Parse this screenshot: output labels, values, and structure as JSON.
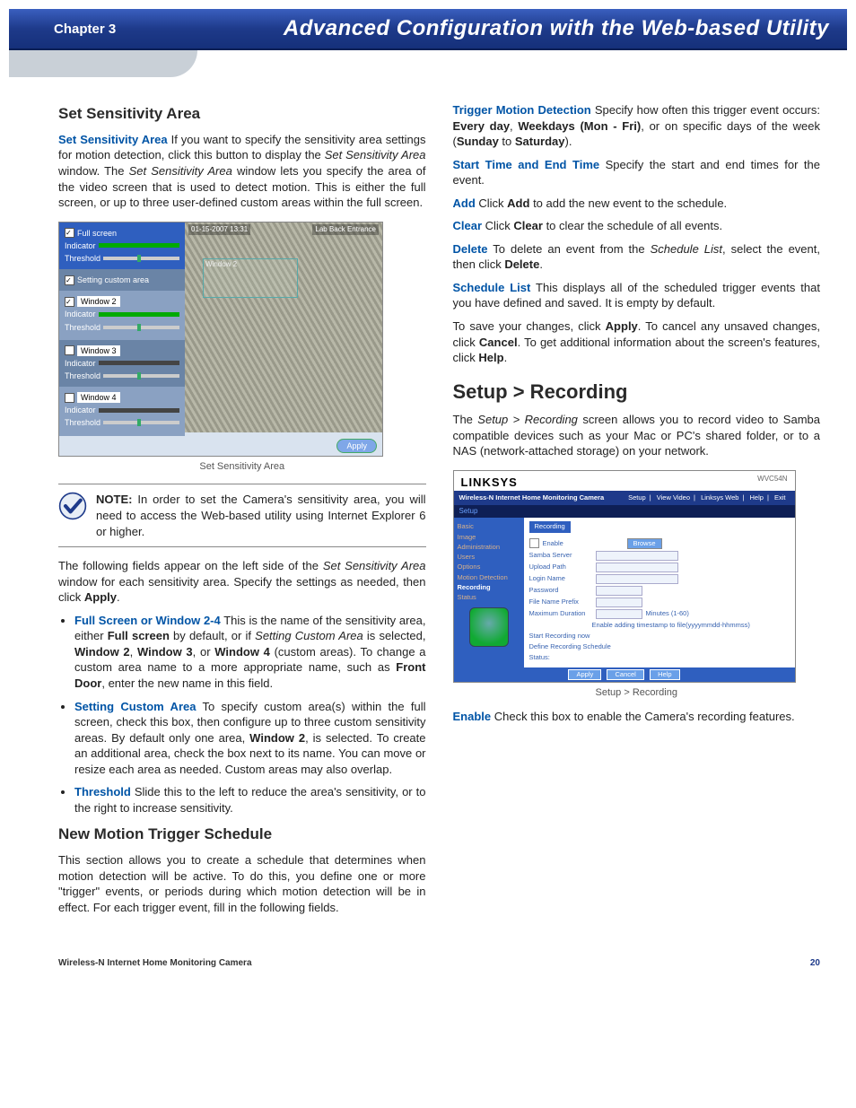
{
  "header": {
    "chapter": "Chapter 3",
    "title": "Advanced Configuration with the Web-based Utility"
  },
  "left": {
    "h2_1": "Set Sensitivity Area",
    "p1_lead": "Set Sensitivity Area",
    "p1_rest": "  If you want to specify the sensitivity area settings for motion detection, click this button to display the ",
    "p1_it1": "Set Sensitivity Area",
    "p1_mid": " window. The ",
    "p1_it2": "Set Sensitivity Area",
    "p1_end": " window lets you specify the area of the video screen that is used to detect motion. This is either the full screen, or up to three user-defined custom areas within the full screen.",
    "shot1": {
      "stamp_left": "01-15-2007 13:31",
      "stamp_right": "Lab Back Entrance",
      "winlabel": "Window 2",
      "groups": {
        "full": {
          "chk": true,
          "label": "Full screen",
          "ind": "Indicator",
          "thr": "Threshold"
        },
        "custom": {
          "chk": true,
          "label": "Setting custom area"
        },
        "w2": {
          "label": "Window 2",
          "ind": "Indicator",
          "thr": "Threshold"
        },
        "w3": {
          "label": "Window 3",
          "ind": "Indicator",
          "thr": "Threshold"
        },
        "w4": {
          "label": "Window 4",
          "ind": "Indicator",
          "thr": "Threshold"
        }
      },
      "apply": "Apply"
    },
    "cap1": "Set Sensitivity Area",
    "note_label": "NOTE:",
    "note_text": " In order to set the Camera's sensitivity area, you will need to access the Web-based utility using Internet Explorer 6 or higher.",
    "p2a": "The following fields appear on the left side of the ",
    "p2it": "Set Sensitivity Area",
    "p2b": " window for each sensitivity area. Specify the settings as needed, then click ",
    "p2bold": "Apply",
    "p2c": ".",
    "b1_lead": "Full Screen or Window 2-4",
    "b1_txt1": "  This is the name of the sensitivity area, either ",
    "b1_bold1": "Full screen",
    "b1_txt2": " by default, or if ",
    "b1_it": "Setting Custom Area",
    "b1_txt3": " is selected, ",
    "b1_bold2": "Window 2",
    "b1_sep1": ", ",
    "b1_bold3": "Window 3",
    "b1_sep2": ", or ",
    "b1_bold4": "Window 4",
    "b1_txt4": " (custom areas). To change a custom area name to a more appropriate name, such as ",
    "b1_bold5": "Front Door",
    "b1_txt5": ", enter the new name in this field.",
    "b2_lead": "Setting Custom Area",
    "b2_txt1": "  To specify custom area(s) within the full screen, check this box, then configure up to three custom sensitivity areas. By default only one area, ",
    "b2_bold1": "Window 2",
    "b2_txt2": ", is selected. To create an additional area, check the box next to its name. You can move or resize each area as needed. Custom areas may also overlap.",
    "b3_lead": "Threshold",
    "b3_txt": "  Slide this to the left to reduce the area's sensitivity, or to the right to increase sensitivity.",
    "h2_2": "New Motion Trigger Schedule",
    "p3": "This section allows you to create a schedule that determines when motion detection will be active. To do this, you define one or more \"trigger\" events, or periods during which motion detection will be in effect. For each trigger event, fill in the following fields."
  },
  "right": {
    "r1_lead": "Trigger Motion Detection",
    "r1_a": "  Specify how often this trigger event occurs: ",
    "r1_b1": "Every day",
    "r1_s1": ", ",
    "r1_b2": "Weekdays (Mon - Fri)",
    "r1_s2": ", or on specific days of the week (",
    "r1_b3": "Sunday",
    "r1_s3": " to ",
    "r1_b4": "Saturday",
    "r1_s4": ").",
    "r2_lead": "Start Time and End Time",
    "r2_txt": "  Specify the start and end times for the event.",
    "r3_lead": "Add",
    "r3_a": "  Click ",
    "r3_b": "Add",
    "r3_c": " to add the new event to the schedule.",
    "r4_lead": "Clear",
    "r4_a": "  Click ",
    "r4_b": "Clear",
    "r4_c": " to clear the schedule of all events.",
    "r5_lead": "Delete",
    "r5_a": "  To delete an event from the ",
    "r5_it": "Schedule List",
    "r5_b": ", select the event, then click ",
    "r5_bold": "Delete",
    "r5_c": ".",
    "r6_lead": "Schedule List",
    "r6_txt": "  This displays all of the scheduled trigger events that you have defined and saved. It is empty by default.",
    "r7_a": "To save your changes, click ",
    "r7_b1": "Apply",
    "r7_b": ". To cancel any unsaved changes, click ",
    "r7_b2": "Cancel",
    "r7_c": ". To get additional information about the screen's features, click ",
    "r7_b3": "Help",
    "r7_d": ".",
    "h1": "Setup > Recording",
    "r8_a": "The ",
    "r8_it": "Setup > Recording",
    "r8_b": " screen allows you to record video to Samba compatible devices such as your Mac or PC's shared folder, or to a NAS (network-attached storage) on your network.",
    "shot2": {
      "brand": "LINKSYS",
      "model": "WVC54N",
      "desc": "Wireless-N Internet Home Monitoring Camera",
      "tabs": [
        "Setup",
        "View Video",
        "Linksys Web",
        "Help",
        "Exit"
      ],
      "subtab": "Setup",
      "side": [
        "Basic",
        "Image",
        "Administration",
        "Users",
        "Options",
        "Motion Detection",
        "Recording",
        "Status"
      ],
      "mtitle": "Recording",
      "fields": {
        "enable": "Enable",
        "samba": "Samba Server",
        "upload": "Upload Path",
        "login": "Login Name",
        "pass": "Password",
        "prefix": "File Name Prefix",
        "maxdur": "Maximum Duration",
        "maxdur_hint": "Minutes (1-60)",
        "note": "Enable adding timestamp to file(yyyymmdd-hhmmss)",
        "start": "Start Recording now",
        "sched": "Define Recording Schedule",
        "status": "Status:"
      },
      "btns": [
        "Apply",
        "Cancel",
        "Help"
      ]
    },
    "cap2": "Setup > Recording",
    "r9_lead": "Enable",
    "r9_txt": "  Check this box to enable the Camera's recording features."
  },
  "footer": {
    "left": "Wireless-N Internet Home Monitoring Camera",
    "right": "20"
  }
}
